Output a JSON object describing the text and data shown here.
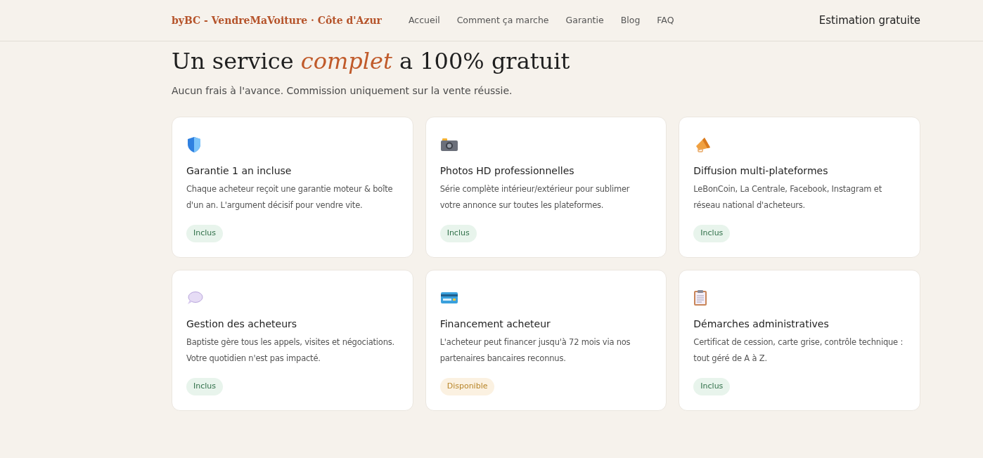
{
  "header": {
    "brand": "byBC - VendreMaVoiture · Côte d'Azur",
    "nav": [
      "Accueil",
      "Comment ça marche",
      "Garantie",
      "Blog",
      "FAQ"
    ],
    "cta": "Estimation gratuite"
  },
  "section": {
    "heading": {
      "before": "Un service ",
      "emphasis": "complet",
      "after": " a 100% gratuit"
    },
    "subtitle": "Aucun frais à l'avance. Commission uniquement sur la vente réussie."
  },
  "features": [
    {
      "title": "Garantie 1 an incluse",
      "text": "Chaque acheteur reçoit une garantie moteur & boîte d'un an. L'argument décisif pour vendre vite.",
      "badge": {
        "kind": "included",
        "label": "Inclus"
      }
    },
    {
      "title": "Photos HD professionnelles",
      "text": "Série complète intérieur/extérieur pour sublimer votre annonce sur toutes les plateformes.",
      "badge": {
        "kind": "included",
        "label": "Inclus"
      }
    },
    {
      "title": "Diffusion multi-plateformes",
      "text": "LeBonCoin, La Centrale, Facebook, Instagram et réseau national d'acheteurs.",
      "badge": {
        "kind": "included",
        "label": "Inclus"
      }
    },
    {
      "title": "Gestion des acheteurs",
      "text": "Baptiste gère tous les appels, visites et négociations. Votre quotidien n'est pas impacté.",
      "badge": {
        "kind": "included",
        "label": "Inclus"
      }
    },
    {
      "title": "Financement acheteur",
      "text": "L'acheteur peut financer jusqu'à 72 mois via nos partenaires bancaires reconnus.",
      "badge": {
        "kind": "available",
        "label": "Disponible"
      }
    },
    {
      "title": "Démarches administratives",
      "text": "Certificat de cession, carte grise, contrôle technique : tout géré de A à Z.",
      "badge": {
        "kind": "included",
        "label": "Inclus"
      }
    }
  ]
}
